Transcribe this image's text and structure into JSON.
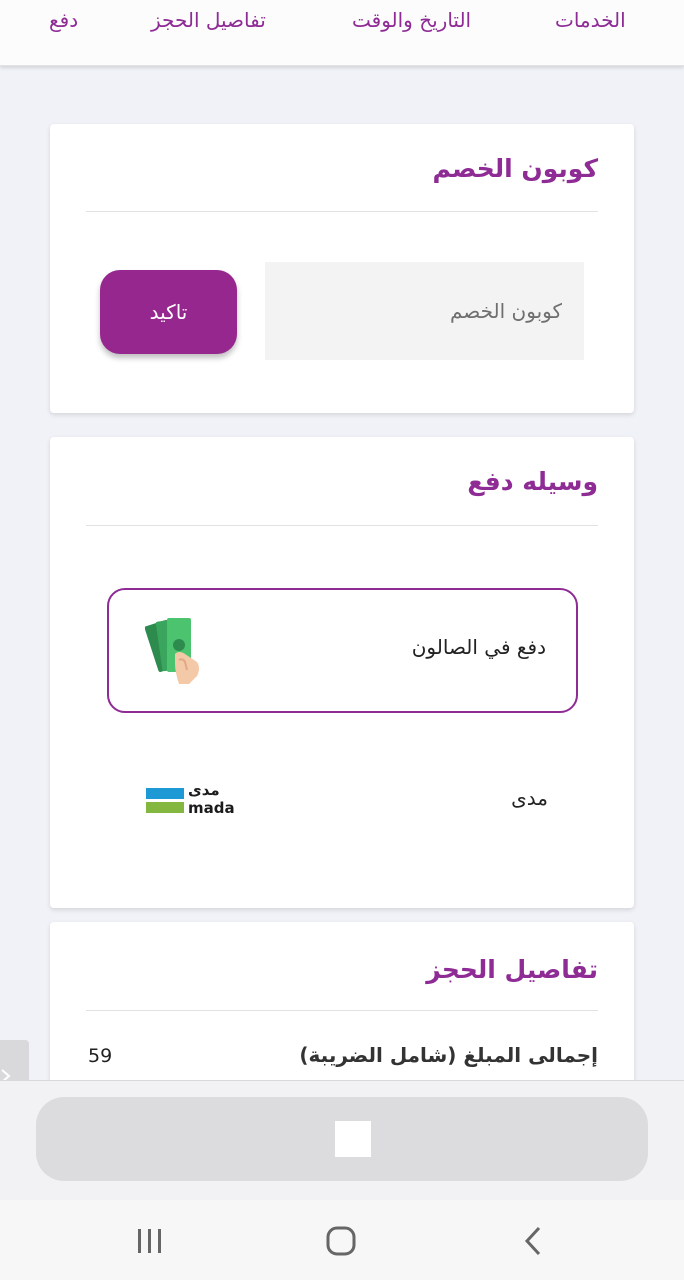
{
  "nav": {
    "tabs": [
      {
        "label": "الخدمات"
      },
      {
        "label": "التاريخ والوقت"
      },
      {
        "label": "تفاصيل الحجز"
      },
      {
        "label": "دفع"
      }
    ]
  },
  "coupon": {
    "title": "كوبون الخصم",
    "input_placeholder": "كوبون الخصم",
    "input_value": "",
    "confirm_label": "تاكيد"
  },
  "payment": {
    "title": "وسيله دفع",
    "options": [
      {
        "label": "دفع في الصالون",
        "icon": "cash-in-hand-icon",
        "selected": true
      },
      {
        "label": "مدى",
        "icon": "mada-logo",
        "logo_text_ar": "مدى",
        "logo_text_en": "mada",
        "selected": false
      }
    ]
  },
  "booking": {
    "title": "تفاصيل الحجز",
    "total_label": "إجمالى المبلغ (شامل الضريبة)",
    "total_value": "59"
  },
  "colors": {
    "accent": "#8e2b95",
    "button": "#96278e",
    "mada_blue": "#1d9ad6",
    "mada_green": "#84b740",
    "cash_green": "#3aa55d"
  },
  "system_nav": {
    "icons": [
      "recent-apps-icon",
      "home-icon",
      "back-icon"
    ]
  }
}
